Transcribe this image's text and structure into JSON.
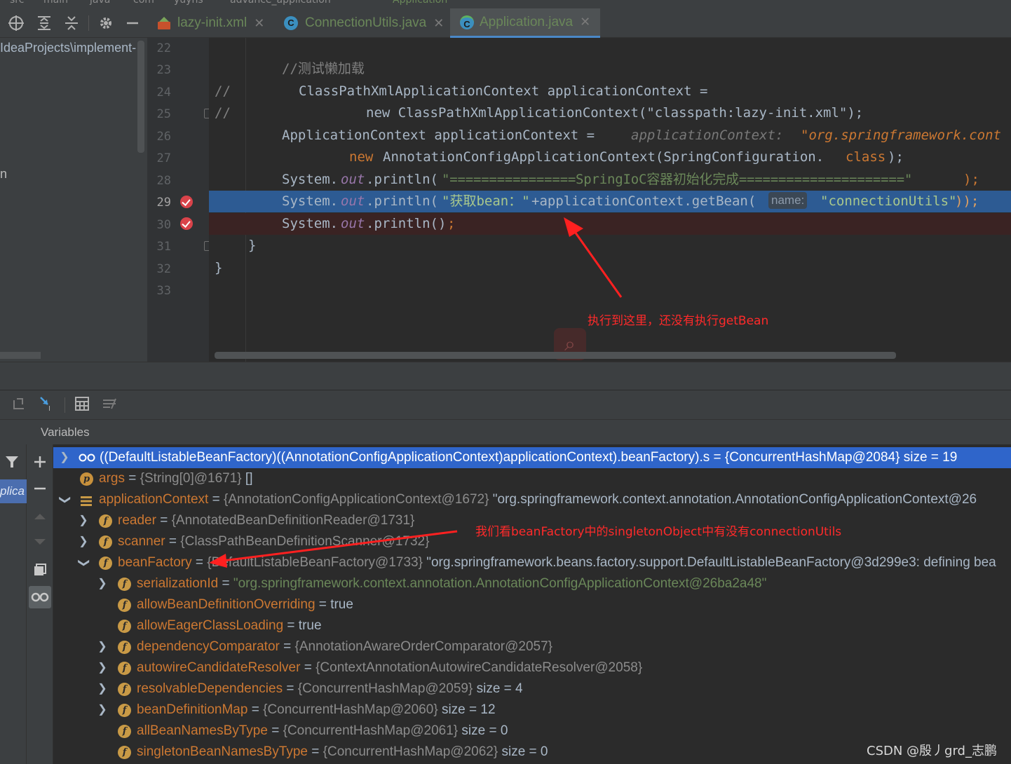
{
  "breadcrumb": [
    "src",
    "main",
    "java",
    "com",
    "yuyhs",
    "advance_application",
    "Application"
  ],
  "tabs": [
    {
      "label": "lazy-init.xml",
      "icon": "xml-file-icon"
    },
    {
      "label": "ConnectionUtils.java",
      "icon": "java-class-icon"
    },
    {
      "label": "Application.java",
      "icon": "java-main-class-icon",
      "active": true
    }
  ],
  "project": {
    "path": "IdeaProjects\\implement-",
    "partial_label": "n"
  },
  "editor": {
    "lines": [
      {
        "num": "22",
        "text": ""
      },
      {
        "num": "23",
        "comment": "//测试懒加载"
      },
      {
        "num": "24",
        "prefix": "//",
        "text": "ClassPathXmlApplicationContext applicationContext ="
      },
      {
        "num": "25",
        "prefix": "//",
        "text": "new ClassPathXmlApplicationContext(\"classpath:lazy-init.xml\");"
      },
      {
        "num": "26",
        "text": "ApplicationContext applicationContext =",
        "hint_name": "applicationContext:",
        "hint_value": "\"org.springframework.cont"
      },
      {
        "num": "27",
        "kw1": "new",
        "text": "AnnotationConfigApplicationContext(SpringConfiguration.",
        "kw2": "class",
        "end": ");"
      },
      {
        "num": "28",
        "s1": "System.",
        "field": "out",
        "s2": ".println(",
        "str": "\"================SpringIoC容器初始化完成=====================\"",
        "end": ");"
      },
      {
        "num": "29",
        "s1": "System.",
        "field": "out",
        "s2": ".println(",
        "str": "\"获取bean：\"",
        "mid": "+applicationContext.getBean(",
        "param_hint": "name:",
        "str2": "\"connectionUtils\"",
        "end": "));"
      },
      {
        "num": "30",
        "s1": "System.",
        "field": "out",
        "s2": ".println()",
        "end": ";"
      },
      {
        "num": "31",
        "text": "}"
      },
      {
        "num": "32",
        "text": "}"
      },
      {
        "num": "33",
        "text": ""
      }
    ]
  },
  "annotation_exec": "执行到这里，还没有执行getBean",
  "annotation_bean": "我们看beanFactory中的singletonObject中有没有connectionUtils",
  "debugger": {
    "variables_title": "Variables",
    "frame_label": "plica",
    "rows": [
      {
        "name": "((DefaultListableBeanFactory)((AnnotationConfigApplicationContext)applicationContext).beanFactory).s",
        "value": " = {ConcurrentHashMap@2084}  size = 19"
      },
      {
        "name": "args",
        "type": "{String[0]@1671}",
        "value": " []"
      },
      {
        "name": "applicationContext",
        "type": "{AnnotationConfigApplicationContext@1672}",
        "value": " \"org.springframework.context.annotation.AnnotationConfigApplicationContext@26"
      },
      {
        "name": "reader",
        "type": "{AnnotatedBeanDefinitionReader@1731}"
      },
      {
        "name": "scanner",
        "type": "{ClassPathBeanDefinitionScanner@1732}"
      },
      {
        "name": "beanFactory",
        "type": "{DefaultListableBeanFactory@1733}",
        "value": " \"org.springframework.beans.factory.support.DefaultListableBeanFactory@3d299e3: defining bea"
      },
      {
        "name": "serializationId",
        "str": "\"org.springframework.context.annotation.AnnotationConfigApplicationContext@26ba2a48\""
      },
      {
        "name": "allowBeanDefinitionOverriding",
        "value": "true"
      },
      {
        "name": "allowEagerClassLoading",
        "value": "true"
      },
      {
        "name": "dependencyComparator",
        "type": "{AnnotationAwareOrderComparator@2057}"
      },
      {
        "name": "autowireCandidateResolver",
        "type": "{ContextAnnotationAutowireCandidateResolver@2058}"
      },
      {
        "name": "resolvableDependencies",
        "type": "{ConcurrentHashMap@2059}",
        "value": "  size = 4"
      },
      {
        "name": "beanDefinitionMap",
        "type": "{ConcurrentHashMap@2060}",
        "value": "  size = 12"
      },
      {
        "name": "allBeanNamesByType",
        "type": "{ConcurrentHashMap@2061}",
        "value": "  size = 0"
      },
      {
        "name": "singletonBeanNamesByType",
        "type": "{ConcurrentHashMap@2062}",
        "value": "  size = 0"
      }
    ]
  },
  "watermark": "CSDN @殷丿grd_志鹏",
  "colors": {
    "keyword": "#cc7832",
    "string": "#6a8759",
    "exec_line": "#2d5b93",
    "selection": "#2f65ca",
    "annotation": "#ff2a2a"
  }
}
